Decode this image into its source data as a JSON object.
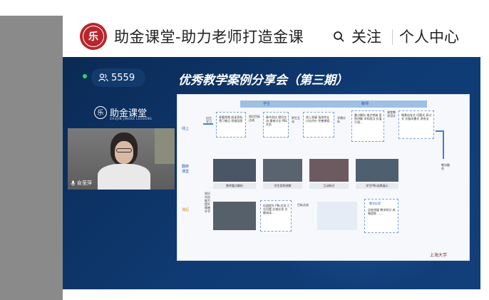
{
  "header": {
    "logo_text": "乐",
    "brand_title": "助金课堂-助力老师打造金课",
    "follow_label": "关注",
    "user_center_label": "个人中心"
  },
  "live": {
    "viewer_count": "5559",
    "slide_title": "优秀教学案例分享会（第三期）",
    "pip_brand": "助金课堂",
    "pip_brand_sub": "ZHUJIN JINGKE LESSONS",
    "teacher_name": "俞莹萍"
  },
  "slide": {
    "student_header": "学生",
    "teacher_header": "教师",
    "online_label": "线上",
    "flip_label": "翻转课堂",
    "after_label": "课后",
    "self_study": "自主学习",
    "blocks": [
      "观看视频 阅读资料 预习笔记 思维导图",
      "知识目标达成",
      "章节测试 提问交流 重难讨论 PBL任务",
      "师生互动",
      "线上答疑 批改作业 讨论评价 完善课程…",
      "学情分析",
      "重点解析 难点突破 案例讲解 学科前沿 价值引领…",
      "课堂教学设计",
      "情景启发式 问题式 研讨式 头脑风暴式 讲授法"
    ],
    "blend_label": "教法融合",
    "captions": [
      "教师重点解析",
      "学生案例讲解",
      "互动研讨",
      "学生PBL成果展示"
    ],
    "knowledge_label": "知识内化 能力提升 情感升华",
    "goal_label": "目标达成",
    "after_block": "巩固提升 PBL任务 汇总问题 反馈反思 文献阅读…",
    "reflect_title": "教学反思",
    "reflect_block": "总结答疑 教学研讨 成果提炼 ……",
    "university": "上海大学"
  }
}
